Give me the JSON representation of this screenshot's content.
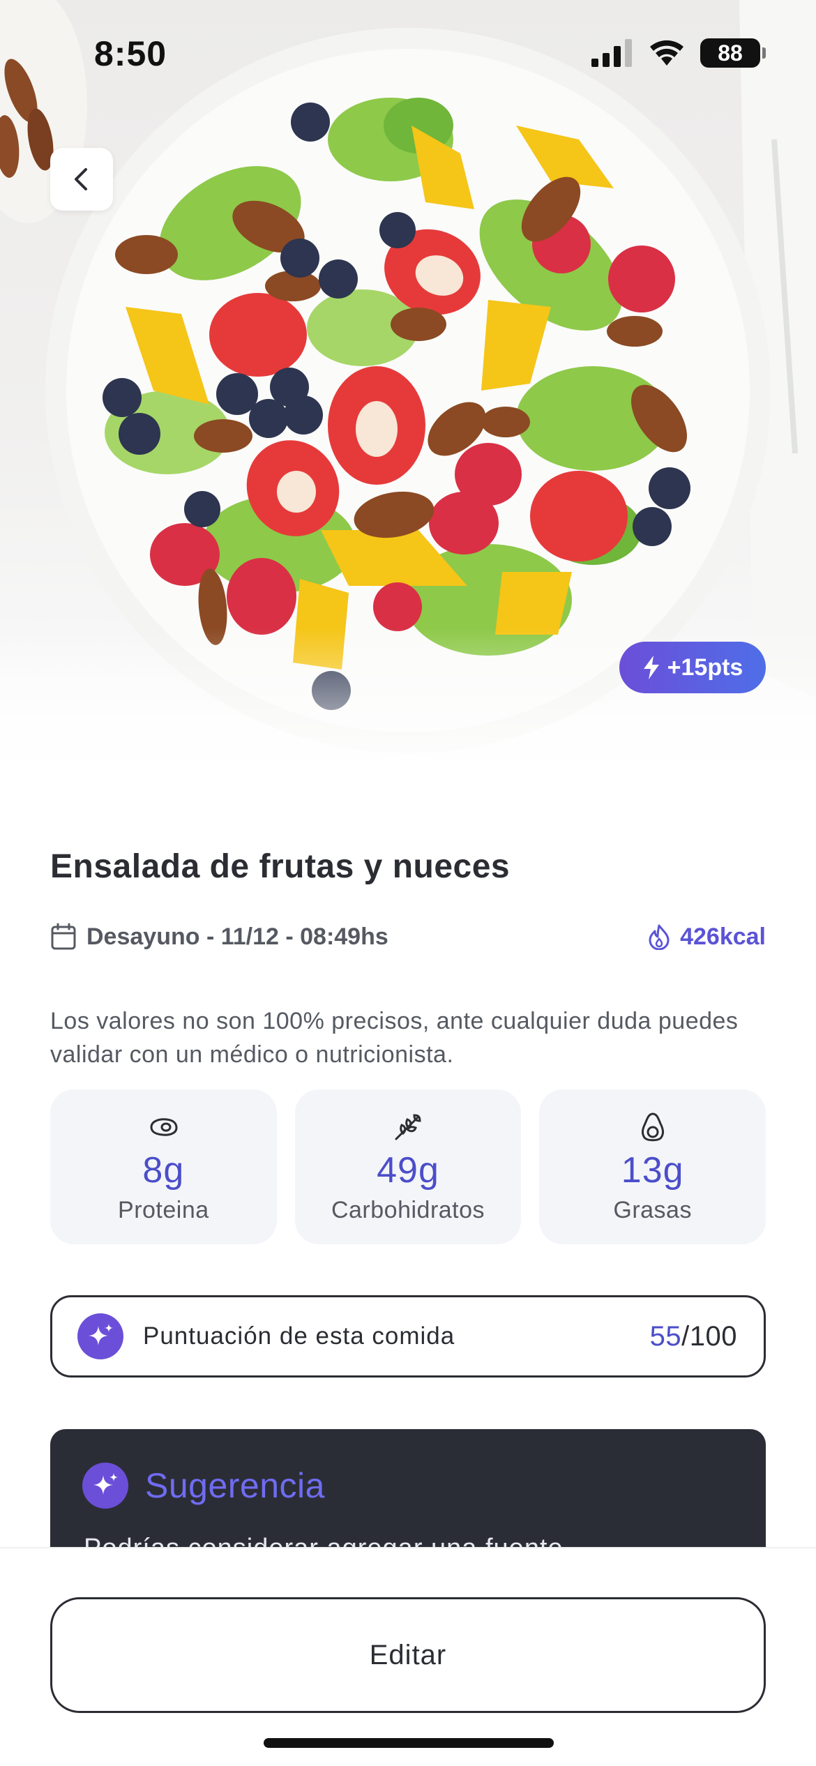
{
  "status_bar": {
    "time": "8:50",
    "battery": "88"
  },
  "hero": {
    "points_badge": "+15pts"
  },
  "meal": {
    "title": "Ensalada de frutas y nueces",
    "meta": "Desayuno - 11/12 - 08:49hs",
    "calories": "426kcal"
  },
  "disclaimer": "Los valores no son 100% precisos, ante cualquier duda puedes validar con un médico o nutricionista.",
  "macros": [
    {
      "value": "8g",
      "label": "Proteina",
      "icon": "meat-icon"
    },
    {
      "value": "49g",
      "label": "Carbohidratos",
      "icon": "wheat-icon"
    },
    {
      "value": "13g",
      "label": "Grasas",
      "icon": "avocado-icon"
    }
  ],
  "score": {
    "label": "Puntuación de esta comida",
    "value": "55",
    "max": "/100"
  },
  "suggestion": {
    "title": "Sugerencia",
    "text": "Podrías considerar agregar una fuente"
  },
  "actions": {
    "edit_label": "Editar"
  },
  "colors": {
    "accent": "#4b4ec9",
    "badge_gradient_start": "#6b4fd8",
    "badge_gradient_end": "#4f6ee8",
    "card_dark": "#2b2d36"
  }
}
